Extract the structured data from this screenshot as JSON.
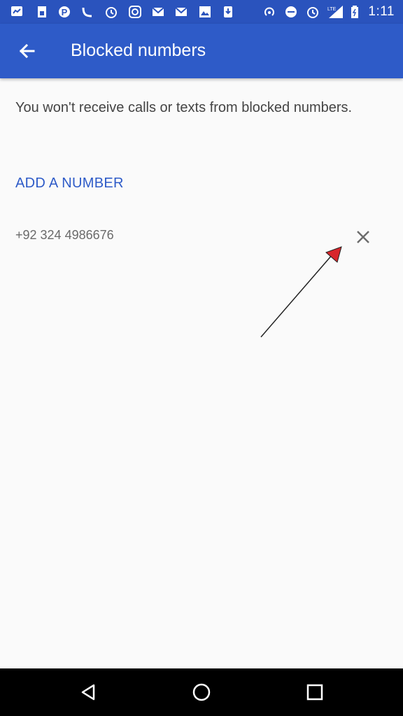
{
  "status_bar": {
    "time": "1:11",
    "network": "LTE",
    "icons": [
      "messenger-icon",
      "sim-icon",
      "pinterest-icon",
      "viber-icon",
      "alarm-icon",
      "instagram-icon",
      "gmail-icon",
      "gmail-icon",
      "photos-icon",
      "download-icon",
      "hotspot-icon",
      "dnd-icon",
      "alarm-icon",
      "signal-icon",
      "battery-icon"
    ]
  },
  "app_bar": {
    "title": "Blocked numbers",
    "back_icon": "arrow-left-icon",
    "color": "#2e5bc8"
  },
  "content": {
    "description": "You won't receive calls or texts from blocked numbers.",
    "add_link": "ADD A NUMBER",
    "blocked": [
      {
        "number": "+92 324 4986676",
        "remove_icon": "close-icon"
      }
    ]
  },
  "annotation": {
    "arrow_color": "#d8262b"
  },
  "nav_bar": {
    "buttons": [
      "back-triangle-icon",
      "home-circle-icon",
      "recents-square-icon"
    ]
  }
}
